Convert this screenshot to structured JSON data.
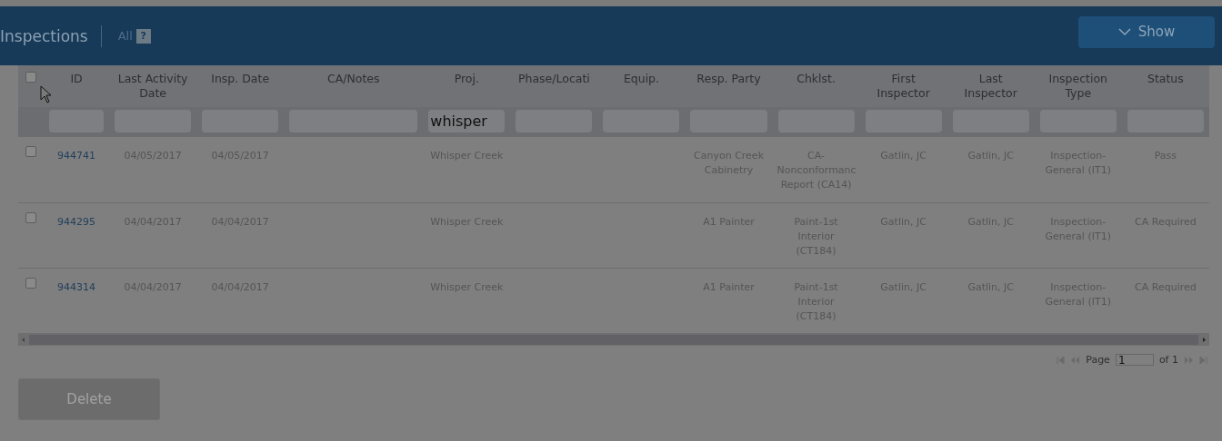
{
  "header": {
    "title": "Inspections",
    "filter_label": "All",
    "help_icon": "?",
    "show_button": "Show"
  },
  "table": {
    "select_all": {
      "checked": false
    },
    "columns": [
      {
        "label": "ID"
      },
      {
        "label": "Last Activity Date"
      },
      {
        "label": "Insp. Date"
      },
      {
        "label": "CA/Notes"
      },
      {
        "label": "Proj.",
        "filter": "whisper"
      },
      {
        "label": "Phase/Locati"
      },
      {
        "label": "Equip."
      },
      {
        "label": "Resp. Party"
      },
      {
        "label": "Chklst."
      },
      {
        "label": "First Inspector"
      },
      {
        "label": "Last Inspector"
      },
      {
        "label": "Inspection Type"
      },
      {
        "label": "Status"
      }
    ],
    "rows": [
      {
        "selected": false,
        "cells": [
          "944741",
          "04/05/2017",
          "04/05/2017",
          "",
          "Whisper Creek",
          "",
          "",
          "Canyon Creek Cabinetry",
          "CA-Nonconformanc Report (CA14)",
          "Gatlin, JC",
          "Gatlin, JC",
          "Inspection-General (IT1)",
          "Pass"
        ]
      },
      {
        "selected": false,
        "cells": [
          "944295",
          "04/04/2017",
          "04/04/2017",
          "",
          "Whisper Creek",
          "",
          "",
          "A1 Painter",
          "Paint-1st Interior (CT184)",
          "Gatlin, JC",
          "Gatlin, JC",
          "Inspection-General (IT1)",
          "CA Required"
        ]
      },
      {
        "selected": false,
        "cells": [
          "944314",
          "04/04/2017",
          "04/04/2017",
          "",
          "Whisper Creek",
          "",
          "",
          "A1 Painter",
          "Paint-1st Interior (CT184)",
          "Gatlin, JC",
          "Gatlin, JC",
          "Inspection-General (IT1)",
          "CA Required"
        ]
      }
    ]
  },
  "pager": {
    "label": "Page",
    "page": "1",
    "of": "of 1"
  },
  "delete_button": {
    "label": "Delete",
    "disabled": true
  }
}
